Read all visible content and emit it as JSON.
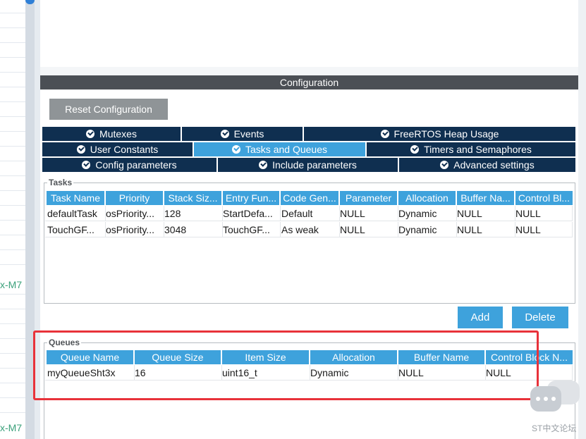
{
  "left_panel": {
    "truncated_labels": [
      "x-M7",
      "x-M7"
    ]
  },
  "configuration": {
    "title": "Configuration",
    "reset_button": "Reset Configuration"
  },
  "tabs": {
    "row1": [
      "Mutexes",
      "Events",
      "FreeRTOS Heap Usage"
    ],
    "row2": [
      "User Constants",
      "Tasks and Queues",
      "Timers and Semaphores"
    ],
    "row3": [
      "Config parameters",
      "Include parameters",
      "Advanced settings"
    ],
    "active": "Tasks and Queues"
  },
  "tasks": {
    "label": "Tasks",
    "columns": [
      "Task Name",
      "Priority",
      "Stack Siz...",
      "Entry Fun...",
      "Code Gen...",
      "Parameter",
      "Allocation",
      "Buffer Na...",
      "Control Bl..."
    ],
    "rows": [
      [
        "defaultTask",
        "osPriority...",
        "128",
        "StartDefa...",
        "Default",
        "NULL",
        "Dynamic",
        "NULL",
        "NULL"
      ],
      [
        "TouchGF...",
        "osPriority...",
        "3048",
        "TouchGF...",
        "As weak",
        "NULL",
        "Dynamic",
        "NULL",
        "NULL"
      ]
    ],
    "add_button": "Add",
    "delete_button": "Delete"
  },
  "queues": {
    "label": "Queues",
    "columns": [
      "Queue Name",
      "Queue Size",
      "Item Size",
      "Allocation",
      "Buffer Name",
      "Control Block N..."
    ],
    "rows": [
      [
        "myQueueSht3x",
        "16",
        "uint16_t",
        "Dynamic",
        "NULL",
        "NULL"
      ]
    ]
  },
  "watermark": {
    "text": "ST中文论坛"
  },
  "colors": {
    "tab_dark": "#0f2f50",
    "accent_blue": "#3ea2dc",
    "header_gray": "#4b4f55",
    "highlight_red": "#e8323a",
    "tree_label_green": "#3aa07a"
  }
}
